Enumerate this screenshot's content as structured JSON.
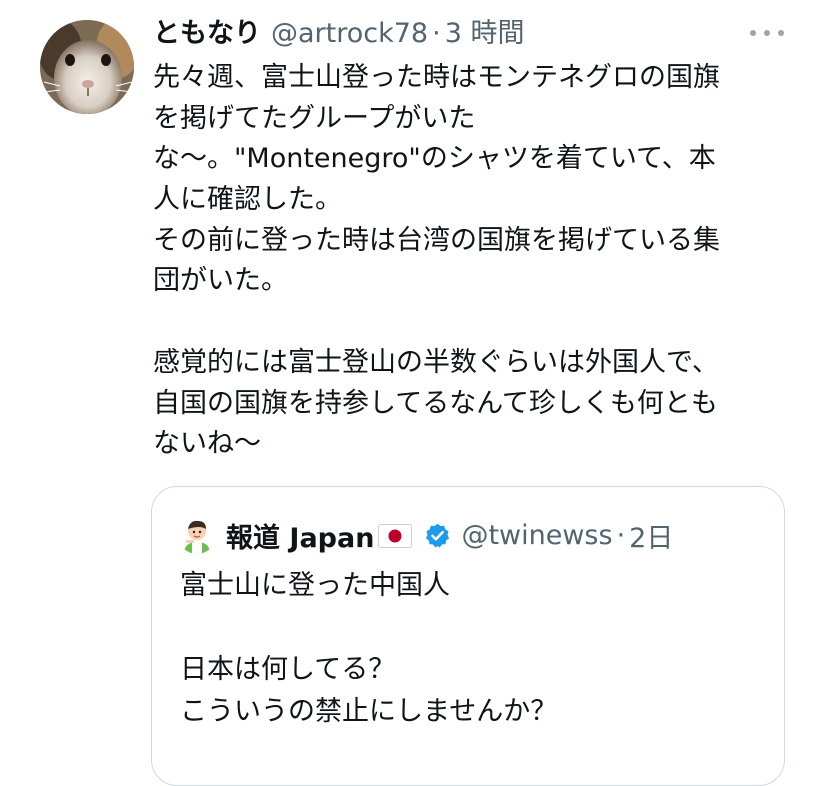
{
  "tweet": {
    "display_name": "ともなり",
    "handle": "@artrock78",
    "separator": "·",
    "time": "3 時間",
    "text_lines": [
      "先々週、富士山登った時はモンテネグロの国旗",
      "を掲げてたグループがいた",
      "な〜。\"Montenegro\"のシャツを着ていて、本",
      "人に確認した。",
      "その前に登った時は台湾の国旗を掲げている集",
      "団がいた。",
      "",
      "感覚的には富士登山の半数ぐらいは外国人で、",
      "自国の国旗を持参してるなんて珍しくも何とも",
      "ないね〜"
    ]
  },
  "quote": {
    "display_name": "報道 Japan",
    "flag_icon": "japan-flag-icon",
    "verified_icon": "verified-badge-icon",
    "handle": "@twinewss",
    "separator": "·",
    "time": "2日",
    "text_lines": [
      "富士山に登った中国人",
      "",
      "日本は何してる？",
      "こういうの禁止にしませんか？"
    ]
  },
  "colors": {
    "text": "#0f1419",
    "secondary": "#536471",
    "border": "#cfd9de",
    "verified": "#1d9bf0"
  }
}
